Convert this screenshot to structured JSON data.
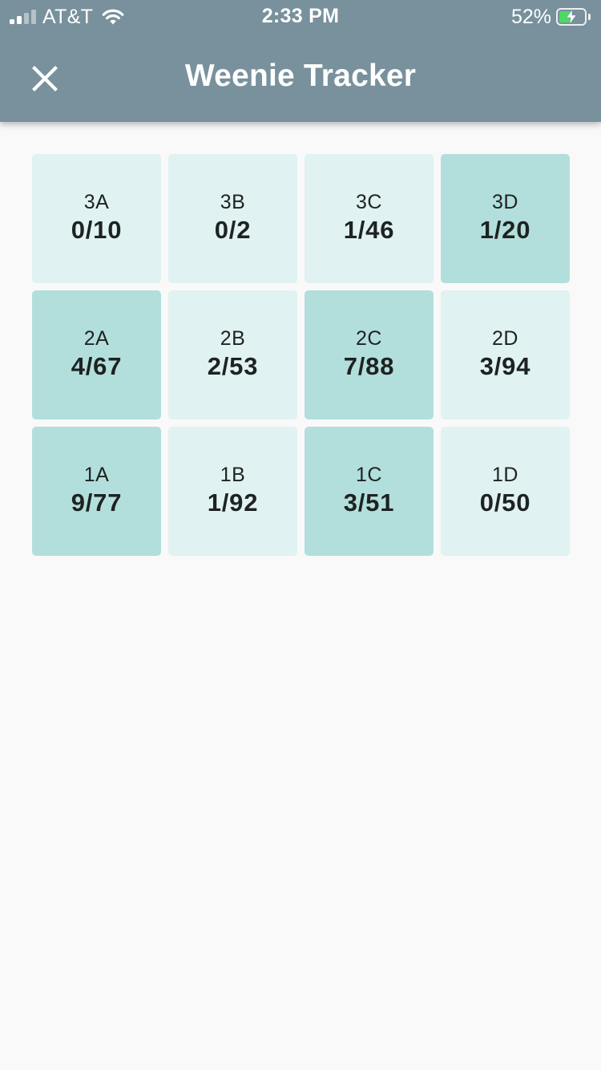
{
  "status_bar": {
    "carrier": "AT&T",
    "time": "2:33 PM",
    "battery_percent": "52%",
    "battery_level": 0.52,
    "signal_bars_active": 2,
    "signal_bars_total": 4,
    "charging": true
  },
  "header": {
    "title": "Weenie Tracker",
    "close_icon": "close-icon"
  },
  "colors": {
    "header_bg": "#78919c",
    "page_bg": "#f9f9f9",
    "cell_light": "#e0f2f1",
    "cell_highlight": "#b2dfdb",
    "text": "#1e2222",
    "battery_green": "#4cd964"
  },
  "grid": {
    "cells": [
      {
        "label": "3A",
        "count": "0/10",
        "highlighted": false
      },
      {
        "label": "3B",
        "count": "0/2",
        "highlighted": false
      },
      {
        "label": "3C",
        "count": "1/46",
        "highlighted": false
      },
      {
        "label": "3D",
        "count": "1/20",
        "highlighted": true
      },
      {
        "label": "2A",
        "count": "4/67",
        "highlighted": true
      },
      {
        "label": "2B",
        "count": "2/53",
        "highlighted": false
      },
      {
        "label": "2C",
        "count": "7/88",
        "highlighted": true
      },
      {
        "label": "2D",
        "count": "3/94",
        "highlighted": false
      },
      {
        "label": "1A",
        "count": "9/77",
        "highlighted": true
      },
      {
        "label": "1B",
        "count": "1/92",
        "highlighted": false
      },
      {
        "label": "1C",
        "count": "3/51",
        "highlighted": true
      },
      {
        "label": "1D",
        "count": "0/50",
        "highlighted": false
      }
    ]
  }
}
